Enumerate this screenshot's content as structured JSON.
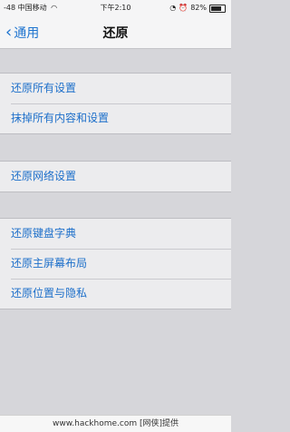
{
  "status_bar": {
    "signal": "-48",
    "carrier": "中国移动",
    "time": "下午2:10",
    "battery": "82%",
    "battery_level": 0.82
  },
  "nav": {
    "back_label": "通用",
    "title": "还原"
  },
  "groups": [
    [
      "还原所有设置",
      "抹掉所有内容和设置"
    ],
    [
      "还原网络设置"
    ],
    [
      "还原键盘字典",
      "还原主屏幕布局",
      "还原位置与隐私"
    ]
  ],
  "footer": "www.hackhome.com [网侠]提供"
}
